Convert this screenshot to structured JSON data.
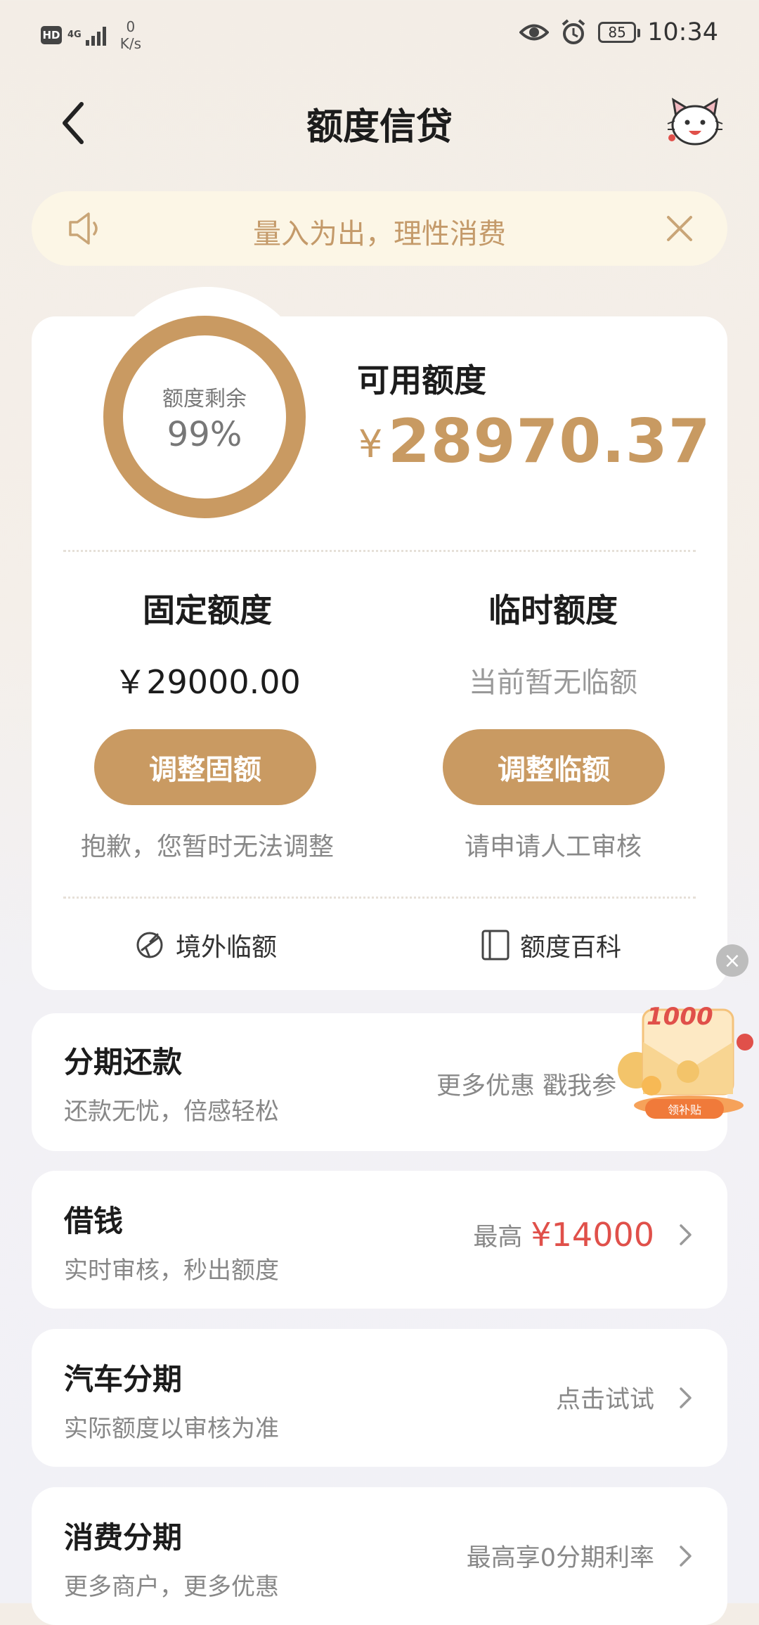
{
  "status_bar": {
    "hd": "HD",
    "network": "4G",
    "speed_value": "0",
    "speed_unit": "K/s",
    "battery": "85",
    "time": "10:34"
  },
  "header": {
    "title": "额度信贷"
  },
  "notice": {
    "text": "量入为出，理性消费"
  },
  "credit": {
    "remaining_label": "额度剩余",
    "remaining_percent": "99%",
    "remaining_fraction": 0.99,
    "available_label": "可用额度",
    "currency": "¥",
    "available_amount": "28970.37"
  },
  "fixed": {
    "title": "固定额度",
    "amount": "￥29000.00",
    "button": "调整固额",
    "note": "抱歉，您暂时无法调整"
  },
  "temporary": {
    "title": "临时额度",
    "amount": "当前暂无临额",
    "button": "调整临额",
    "note": "请申请人工审核"
  },
  "quick_links": {
    "overseas": "境外临额",
    "encyclopedia": "额度百科"
  },
  "list": [
    {
      "title": "分期还款",
      "subtitle": "还款无忧，倍感轻松",
      "right": "更多优惠 戳我参"
    },
    {
      "title": "借钱",
      "subtitle": "实时审核，秒出额度",
      "right_prefix": "最高",
      "right_value": "¥14000"
    },
    {
      "title": "汽车分期",
      "subtitle": "实际额度以审核为准",
      "right": "点击试试"
    },
    {
      "title": "消费分期",
      "subtitle": "更多商户，更多优惠",
      "right": "最高享0分期利率"
    }
  ],
  "promo": {
    "amount": "1000",
    "button": "领补贴"
  },
  "colors": {
    "accent": "#c99a62",
    "red": "#e0504a"
  }
}
